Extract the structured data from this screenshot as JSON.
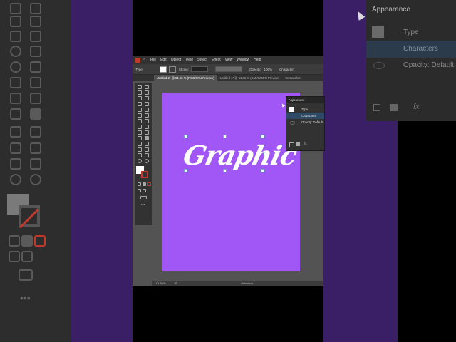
{
  "menu": [
    "File",
    "Edit",
    "Object",
    "Type",
    "Select",
    "Effect",
    "View",
    "Window",
    "Help"
  ],
  "control_bar": {
    "type_label": "Type",
    "stroke_label": "Stroke:",
    "opacity_label": "Opacity:",
    "opacity_value": "100%",
    "character_label": "Character:"
  },
  "tabs": [
    {
      "label": "Untitled-2* @ 51.86 % (RGB/CPU Preview)",
      "active": true
    },
    {
      "label": "Untitled-1* @ 51.86 % (CMYK/CPU Preview)",
      "active": false
    },
    {
      "label": "Screenshot",
      "active": false
    }
  ],
  "artboard": {
    "text": "Graphic",
    "fill_color": "#a157f5"
  },
  "status": {
    "zoom": "51.86%",
    "rotation": "0°",
    "mode": "Selection"
  },
  "appearance_panel": {
    "title": "Appearance",
    "type_label": "Type",
    "characters_label": "Characters",
    "opacity_label": "Opacity:",
    "opacity_value": "Default",
    "fx_label": "fx."
  },
  "colors": {
    "accent": "#a157f5",
    "dark_purple": "#3b1f66",
    "ui_dark": "#323232"
  }
}
